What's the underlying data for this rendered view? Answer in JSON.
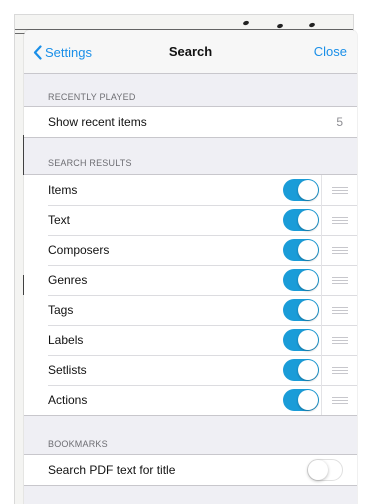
{
  "nav": {
    "back_label": "Settings",
    "title": "Search",
    "close_label": "Close"
  },
  "sections": {
    "recent": {
      "header": "Recently Played",
      "row_label": "Show recent items",
      "row_value": "5"
    },
    "results": {
      "header": "Search Results",
      "items": [
        {
          "label": "Items",
          "enabled": true
        },
        {
          "label": "Text",
          "enabled": true
        },
        {
          "label": "Composers",
          "enabled": true
        },
        {
          "label": "Genres",
          "enabled": true
        },
        {
          "label": "Tags",
          "enabled": true
        },
        {
          "label": "Labels",
          "enabled": true
        },
        {
          "label": "Setlists",
          "enabled": true
        },
        {
          "label": "Actions",
          "enabled": true
        }
      ]
    },
    "bookmarks": {
      "header": "Bookmarks",
      "row_label": "Search PDF text for title",
      "enabled": false
    }
  },
  "colors": {
    "accent": "#1a8fe8",
    "toggle_on": "#1a9cd8"
  },
  "icons": {
    "back": "chevron-left-icon",
    "reorder": "drag-handle-icon"
  }
}
